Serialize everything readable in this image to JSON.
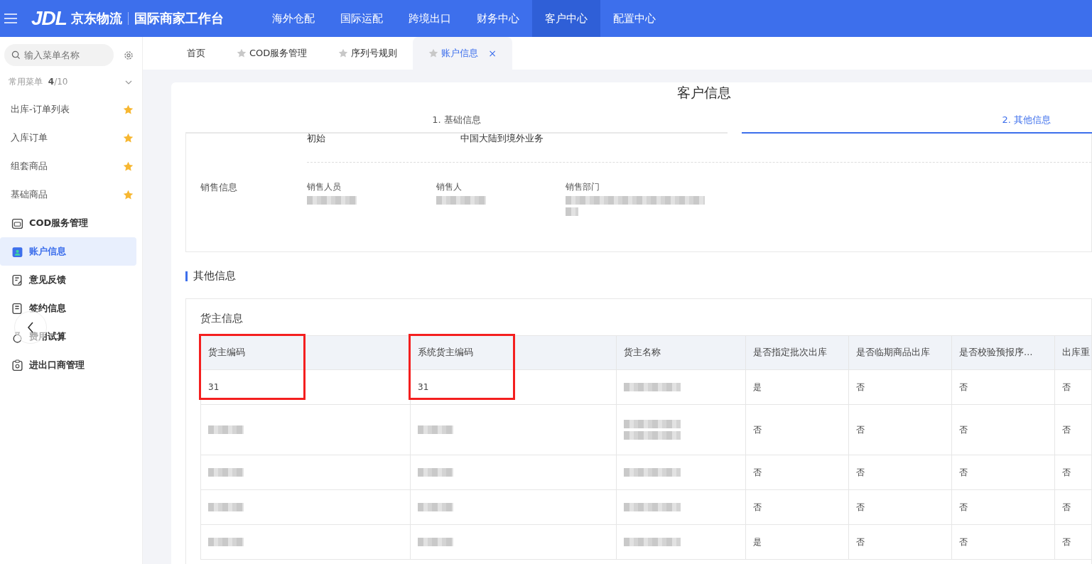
{
  "header": {
    "logo": "JDL",
    "brand": "京东物流",
    "product": "国际商家工作台",
    "nav": [
      {
        "label": "海外仓配",
        "selected": false
      },
      {
        "label": "国际运配",
        "selected": false
      },
      {
        "label": "跨境出口",
        "selected": false
      },
      {
        "label": "财务中心",
        "selected": false
      },
      {
        "label": "客户中心",
        "selected": true
      },
      {
        "label": "配置中心",
        "selected": false
      }
    ]
  },
  "sidebar": {
    "search": {
      "placeholder": "输入菜单名称"
    },
    "favorites_label": "常用菜单",
    "favorites_count": "4",
    "favorites_max": "/10",
    "favorites": [
      {
        "label": "出库-订单列表",
        "starred": true
      },
      {
        "label": "入库订单",
        "starred": true
      },
      {
        "label": "组套商品",
        "starred": true
      },
      {
        "label": "基础商品",
        "starred": true
      }
    ],
    "items": [
      {
        "label": "COD服务管理",
        "kind": "cod",
        "selected": false
      },
      {
        "label": "账户信息",
        "kind": "account",
        "selected": true
      },
      {
        "label": "意见反馈",
        "kind": "feedback",
        "selected": false
      },
      {
        "label": "签约信息",
        "kind": "contract",
        "selected": false
      },
      {
        "label": "费用试算",
        "kind": "fee",
        "selected": false
      },
      {
        "label": "进出口商管理",
        "kind": "trader",
        "selected": false
      }
    ]
  },
  "page_tabs": [
    {
      "label": "首页",
      "starrable": false,
      "selected": false,
      "closable": false
    },
    {
      "label": "COD服务管理",
      "starrable": true,
      "selected": false,
      "closable": false
    },
    {
      "label": "序列号规则",
      "starrable": true,
      "selected": false,
      "closable": false
    },
    {
      "label": "账户信息",
      "starrable": true,
      "selected": true,
      "closable": true,
      "close": "×"
    }
  ],
  "page_title": "客户信息",
  "steps": [
    {
      "label": "1. 基础信息",
      "selected": false
    },
    {
      "label": "2. 其他信息",
      "selected": true
    }
  ],
  "basic_top_values": [
    "初始",
    "中国大陆到境外业务"
  ],
  "sales": {
    "label": "销售信息",
    "fields": [
      {
        "label": "销售人员"
      },
      {
        "label": "销售人"
      },
      {
        "label": "销售部门"
      }
    ]
  },
  "other_section": "其他信息",
  "owner_panel": {
    "title": "货主信息",
    "columns": [
      {
        "label": "货主编码",
        "highlighted": true
      },
      {
        "label": "系统货主编码",
        "highlighted": true
      },
      {
        "label": "货主名称",
        "highlighted": false
      },
      {
        "label": "是否指定批次出库",
        "highlighted": false
      },
      {
        "label": "是否临期商品出库",
        "highlighted": false
      },
      {
        "label": "是否校验预报序…",
        "highlighted": false
      },
      {
        "label": "出库重",
        "highlighted": false
      }
    ],
    "rows": [
      {
        "tall": false,
        "cells": [
          {
            "kind": "text",
            "text": "31"
          },
          {
            "kind": "text",
            "text": "31"
          },
          {
            "kind": "redacted"
          },
          {
            "kind": "text",
            "text": "是"
          },
          {
            "kind": "text",
            "text": "否"
          },
          {
            "kind": "text",
            "text": "否"
          },
          {
            "kind": "text",
            "text": "否"
          }
        ]
      },
      {
        "tall": true,
        "cells": [
          {
            "kind": "redacted"
          },
          {
            "kind": "redacted"
          },
          {
            "kind": "redacted"
          },
          {
            "kind": "text",
            "text": "否"
          },
          {
            "kind": "text",
            "text": "否"
          },
          {
            "kind": "text",
            "text": "否"
          },
          {
            "kind": "text",
            "text": "否"
          }
        ]
      },
      {
        "tall": false,
        "cells": [
          {
            "kind": "redacted"
          },
          {
            "kind": "redacted"
          },
          {
            "kind": "redacted"
          },
          {
            "kind": "text",
            "text": "否"
          },
          {
            "kind": "text",
            "text": "否"
          },
          {
            "kind": "text",
            "text": "否"
          },
          {
            "kind": "text",
            "text": "否"
          }
        ]
      },
      {
        "tall": false,
        "cells": [
          {
            "kind": "redacted"
          },
          {
            "kind": "redacted"
          },
          {
            "kind": "redacted"
          },
          {
            "kind": "text",
            "text": "否"
          },
          {
            "kind": "text",
            "text": "否"
          },
          {
            "kind": "text",
            "text": "否"
          },
          {
            "kind": "text",
            "text": "否"
          }
        ]
      },
      {
        "tall": false,
        "cells": [
          {
            "kind": "redacted"
          },
          {
            "kind": "redacted"
          },
          {
            "kind": "redacted"
          },
          {
            "kind": "text",
            "text": "是"
          },
          {
            "kind": "text",
            "text": "否"
          },
          {
            "kind": "text",
            "text": "否"
          },
          {
            "kind": "text",
            "text": "否"
          }
        ]
      }
    ]
  }
}
